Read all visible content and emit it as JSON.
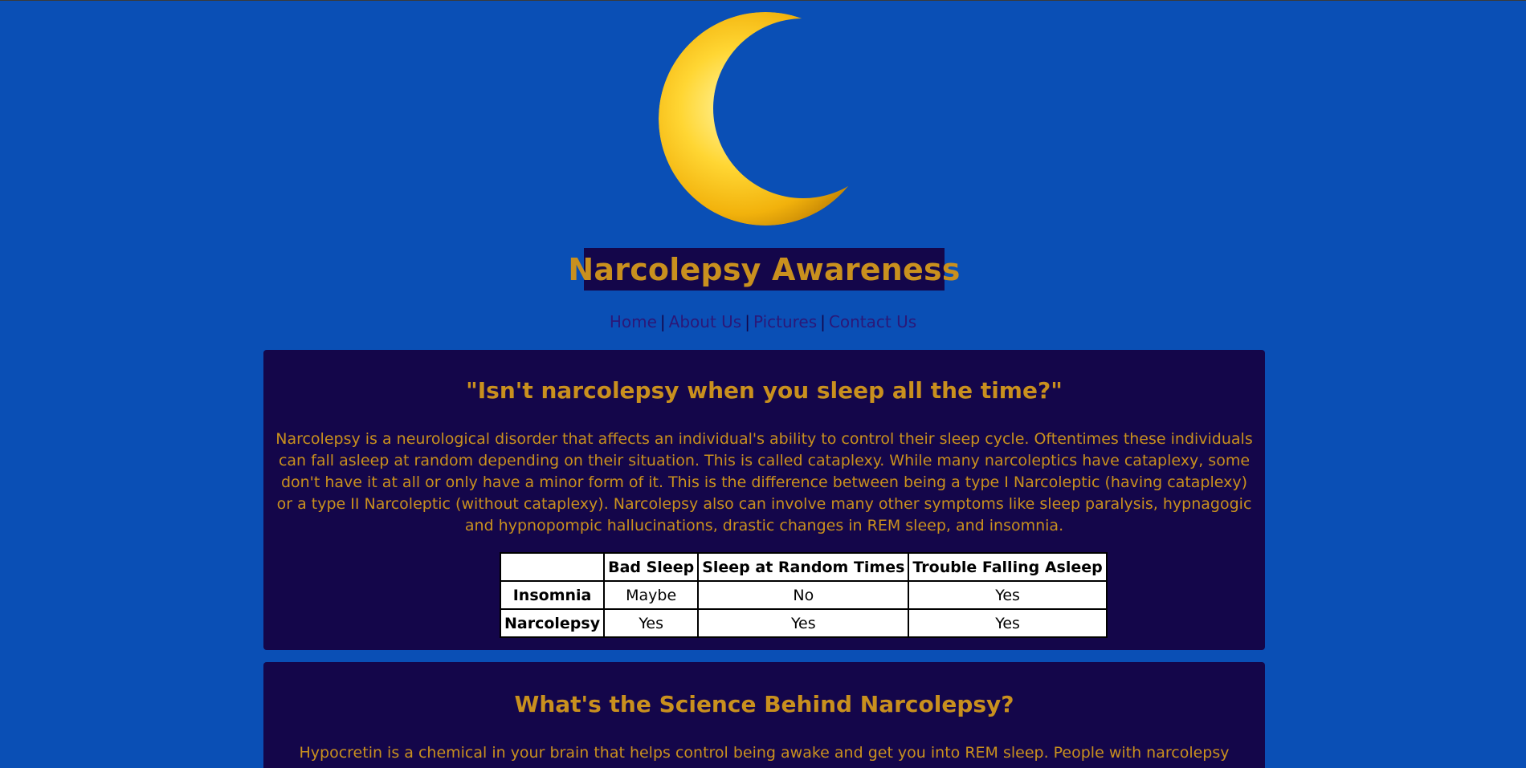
{
  "header": {
    "logo_icon": "crescent-moon-icon",
    "title": "Narcolepsy Awareness"
  },
  "nav": {
    "items": [
      "Home",
      "About Us",
      "Pictures",
      "Contact Us"
    ],
    "separator": "|"
  },
  "sections": [
    {
      "heading": "\"Isn't narcolepsy when you sleep all the time?\"",
      "paragraph": "Narcolepsy is a neurological disorder that affects an individual's ability to control their sleep cycle. Oftentimes these individuals can fall asleep at random depending on their situation. This is called cataplexy. While many narcoleptics have cataplexy, some don't have it at all or only have a minor form of it. This is the difference between being a type I Narcoleptic (having cataplexy) or a type II Narcoleptic (without cataplexy). Narcolepsy also can involve many other symptoms like sleep paralysis, hypnagogic and hypnopompic hallucinations, drastic changes in REM sleep, and insomnia.",
      "table": {
        "headers": [
          "",
          "Bad Sleep",
          "Sleep at Random Times",
          "Trouble Falling Asleep"
        ],
        "rows": [
          {
            "label": "Insomnia",
            "cells": [
              "Maybe",
              "No",
              "Yes"
            ]
          },
          {
            "label": "Narcolepsy",
            "cells": [
              "Yes",
              "Yes",
              "Yes"
            ]
          }
        ]
      }
    },
    {
      "heading": "What's the Science Behind Narcolepsy?",
      "paragraph": "Hypocretin is a chemical in your brain that helps control being awake and get you into REM sleep. People with narcolepsy cannot properly"
    }
  ],
  "colors": {
    "background": "#0a4fb5",
    "panel": "#14064a",
    "accent_text": "#c9901e",
    "nav_link": "#2b1878",
    "moon_gold": "#f5c21b"
  }
}
